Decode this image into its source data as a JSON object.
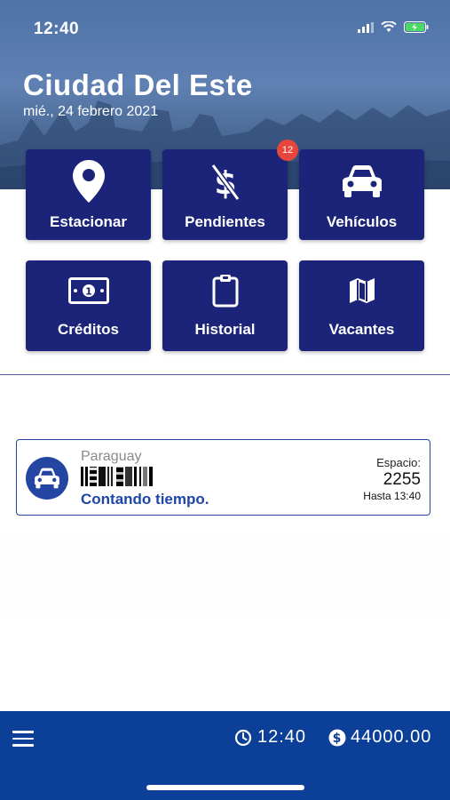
{
  "status_bar": {
    "time": "12:40"
  },
  "header": {
    "city": "Ciudad Del Este",
    "date": "mié., 24 febrero  2021"
  },
  "tiles": [
    {
      "label": "Estacionar",
      "icon": "location-pin-icon"
    },
    {
      "label": "Pendientes",
      "icon": "dollar-slash-icon",
      "badge": "12"
    },
    {
      "label": "Vehículos",
      "icon": "car-icon"
    },
    {
      "label": "Créditos",
      "icon": "money-bill-icon"
    },
    {
      "label": "Historial",
      "icon": "clipboard-icon"
    },
    {
      "label": "Vacantes",
      "icon": "map-icon"
    }
  ],
  "session": {
    "country": "Paraguay",
    "status": "Contando tiempo.",
    "space_label": "Espacio:",
    "space": "2255",
    "until": "Hasta 13:40"
  },
  "bottom_bar": {
    "clock": "12:40",
    "balance": "44000.00"
  },
  "colors": {
    "tile": "#1c2479",
    "bottom_bar": "#0b3f98",
    "accent_text": "#1d47a6",
    "badge": "#e8463c"
  }
}
